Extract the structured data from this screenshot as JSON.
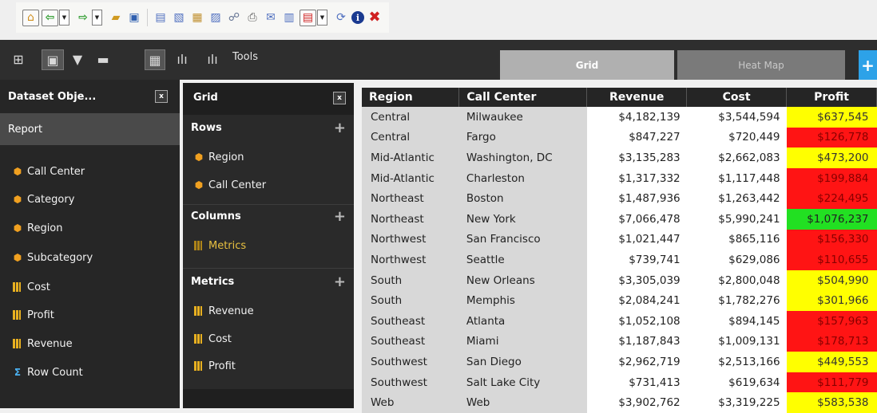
{
  "colors": {
    "good": "#ffff00",
    "bad": "#ff1414",
    "great": "#22e022",
    "accent": "#2da2e8"
  },
  "toolbar": {
    "icons": [
      "home-icon",
      "back-arrow-icon",
      "forward-arrow-icon",
      "open-folder-icon",
      "save-icon",
      "export-icon",
      "pdf-icon",
      "info-icon",
      "close-icon"
    ]
  },
  "topbar": {
    "tools_label": "Tools",
    "tabs": [
      {
        "label": "Grid"
      },
      {
        "label": "Heat Map"
      }
    ],
    "add_tab_label": "+"
  },
  "dataset_panel": {
    "title": "Dataset Obje...",
    "close_label": "x",
    "report_label": "Report",
    "items": [
      {
        "label": "Call Center",
        "type": "attribute"
      },
      {
        "label": "Category",
        "type": "attribute"
      },
      {
        "label": "Region",
        "type": "attribute"
      },
      {
        "label": "Subcategory",
        "type": "attribute"
      },
      {
        "label": "Cost",
        "type": "metric"
      },
      {
        "label": "Profit",
        "type": "metric"
      },
      {
        "label": "Revenue",
        "type": "metric"
      },
      {
        "label": "Row Count",
        "type": "rowcount"
      }
    ]
  },
  "grid_panel": {
    "title": "Grid",
    "close_label": "x",
    "rows": {
      "title": "Rows",
      "items": [
        "Region",
        "Call Center"
      ]
    },
    "columns": {
      "title": "Columns",
      "items": [
        "Metrics"
      ]
    },
    "metrics": {
      "title": "Metrics",
      "items": [
        "Revenue",
        "Cost",
        "Profit"
      ]
    }
  },
  "table": {
    "headers": [
      "Region",
      "Call Center",
      "Revenue",
      "Cost",
      "Profit"
    ],
    "rows": [
      {
        "region": "Central",
        "call_center": "Milwaukee",
        "revenue": "$4,182,139",
        "cost": "$3,544,594",
        "profit": "$637,545",
        "band": "ok"
      },
      {
        "region": "Central",
        "call_center": "Fargo",
        "revenue": "$847,227",
        "cost": "$720,449",
        "profit": "$126,778",
        "band": "bad"
      },
      {
        "region": "Mid-Atlantic",
        "call_center": "Washington, DC",
        "revenue": "$3,135,283",
        "cost": "$2,662,083",
        "profit": "$473,200",
        "band": "ok"
      },
      {
        "region": "Mid-Atlantic",
        "call_center": "Charleston",
        "revenue": "$1,317,332",
        "cost": "$1,117,448",
        "profit": "$199,884",
        "band": "bad"
      },
      {
        "region": "Northeast",
        "call_center": "Boston",
        "revenue": "$1,487,936",
        "cost": "$1,263,442",
        "profit": "$224,495",
        "band": "bad"
      },
      {
        "region": "Northeast",
        "call_center": "New York",
        "revenue": "$7,066,478",
        "cost": "$5,990,241",
        "profit": "$1,076,237",
        "band": "great"
      },
      {
        "region": "Northwest",
        "call_center": "San Francisco",
        "revenue": "$1,021,447",
        "cost": "$865,116",
        "profit": "$156,330",
        "band": "bad"
      },
      {
        "region": "Northwest",
        "call_center": "Seattle",
        "revenue": "$739,741",
        "cost": "$629,086",
        "profit": "$110,655",
        "band": "bad"
      },
      {
        "region": "South",
        "call_center": "New Orleans",
        "revenue": "$3,305,039",
        "cost": "$2,800,048",
        "profit": "$504,990",
        "band": "ok"
      },
      {
        "region": "South",
        "call_center": "Memphis",
        "revenue": "$2,084,241",
        "cost": "$1,782,276",
        "profit": "$301,966",
        "band": "ok"
      },
      {
        "region": "Southeast",
        "call_center": "Atlanta",
        "revenue": "$1,052,108",
        "cost": "$894,145",
        "profit": "$157,963",
        "band": "bad"
      },
      {
        "region": "Southeast",
        "call_center": "Miami",
        "revenue": "$1,187,843",
        "cost": "$1,009,131",
        "profit": "$178,713",
        "band": "bad"
      },
      {
        "region": "Southwest",
        "call_center": "San Diego",
        "revenue": "$2,962,719",
        "cost": "$2,513,166",
        "profit": "$449,553",
        "band": "ok"
      },
      {
        "region": "Southwest",
        "call_center": "Salt Lake City",
        "revenue": "$731,413",
        "cost": "$619,634",
        "profit": "$111,779",
        "band": "bad"
      },
      {
        "region": "Web",
        "call_center": "Web",
        "revenue": "$3,902,762",
        "cost": "$3,319,225",
        "profit": "$583,538",
        "band": "ok"
      }
    ]
  }
}
